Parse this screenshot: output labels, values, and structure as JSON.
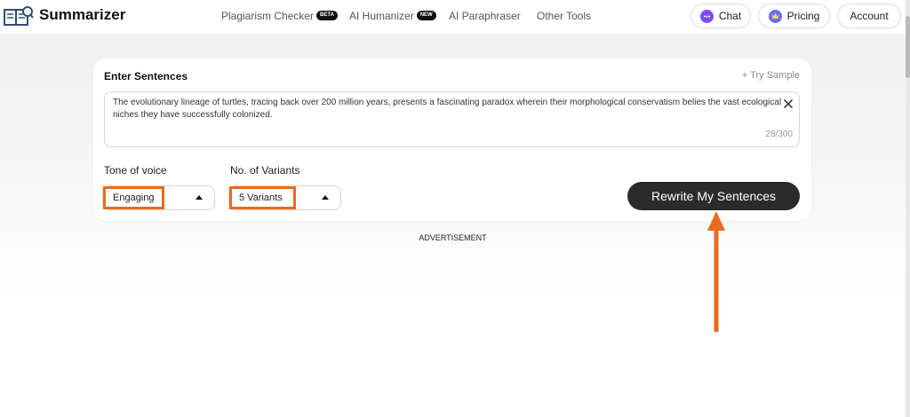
{
  "app": {
    "name": "Summarizer"
  },
  "nav": [
    {
      "label": "Plagiarism Checker",
      "badge": "BETA"
    },
    {
      "label": "AI Humanizer",
      "badge": "NEW"
    },
    {
      "label": "AI Paraphraser",
      "badge": ""
    },
    {
      "label": "Other Tools",
      "badge": ""
    }
  ],
  "header_buttons": {
    "chat": "Chat",
    "pricing": "Pricing",
    "account": "Account"
  },
  "card": {
    "title": "Enter Sentences",
    "try_sample": "+ Try Sample",
    "input_text": "The evolutionary lineage of turtles, tracing back over 200 million years, presents a fascinating paradox wherein their morphological conservatism belies the vast ecological niches they have successfully colonized.",
    "counter": "28/300"
  },
  "tone": {
    "label": "Tone of voice",
    "value": "Engaging"
  },
  "variants": {
    "label": "No. of Variants",
    "value": "5 Variants"
  },
  "rewrite_button": "Rewrite My Sentences",
  "advertisement": "ADVERTISEMENT",
  "colors": {
    "highlight": "#ec6a1e",
    "button_bg": "#2b2b2b",
    "chat_icon": "#7c4dff",
    "pricing_icon": "#6d6bff"
  },
  "icons": [
    "books-logo-icon",
    "chat-icon",
    "crown-icon",
    "close-icon",
    "caret-up-icon",
    "annotation-arrow-icon"
  ]
}
